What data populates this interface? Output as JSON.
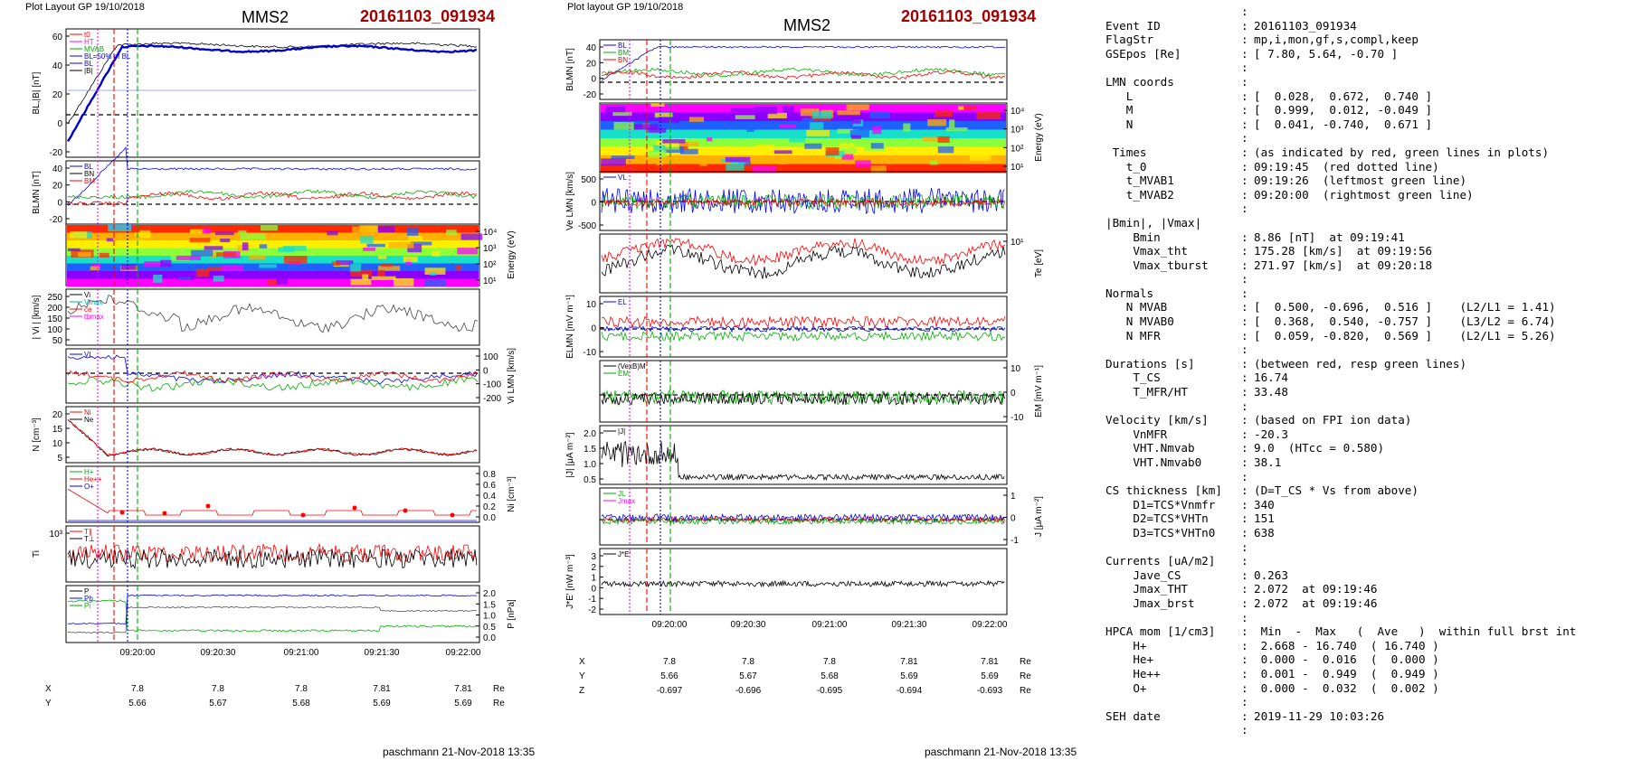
{
  "header": {
    "left_plot_label": "Plot Layout GP 19/10/2018",
    "right_plot_label": "Plot layout GP 19/10/2018",
    "spacecraft": "MMS2",
    "event": "20161103_091934"
  },
  "footer": {
    "signature": "paschmann 21-Nov-2018 13:35"
  },
  "colors": {
    "event_red": "#a00000",
    "bl_blue": "#0000cc"
  },
  "chart_data": [
    {
      "type": "line",
      "title": "MMS2",
      "x_ticks": [
        "09:20:00",
        "09:20:30",
        "09:21:00",
        "09:21:30",
        "09:22:00"
      ],
      "ephemeris": {
        "X": {
          "label": "X",
          "values": [
            "7.8",
            "7.8",
            "7.8",
            "7.81",
            "7.81"
          ],
          "unit": "Re"
        },
        "Y": {
          "label": "Y",
          "values": [
            "5.66",
            "5.67",
            "5.68",
            "5.69",
            "5.69"
          ],
          "unit": "Re"
        },
        "Z": {
          "label": "Z",
          "values": [
            "-0.697",
            "-0.696",
            "-0.695",
            "-0.694",
            "-0.693"
          ],
          "unit": "Re"
        }
      },
      "panels": [
        {
          "ylabel": "BL,|B| [nT]",
          "ylim": [
            -30,
            60
          ],
          "ticks": [
            "60",
            "40",
            "20",
            "0",
            "-20"
          ],
          "legend": [
            "t0",
            "HT",
            "MVAB",
            "BL=50% of BL",
            "BL",
            "|B|"
          ]
        },
        {
          "ylabel": "BLMN [nT]",
          "ylim": [
            -20,
            50
          ],
          "ticks": [
            "40",
            "20",
            "0",
            "-20"
          ],
          "legend": [
            "BL",
            "BN",
            "BM"
          ]
        },
        {
          "ylabel": "Energy (eV)",
          "ticks": [
            "10⁴",
            "10³",
            "10²",
            "10¹"
          ]
        },
        {
          "ylabel": "| Vi | [km/s]",
          "ylim": [
            0,
            280
          ],
          "ticks": [
            "250",
            "200",
            "150",
            "100",
            "50"
          ],
          "legend": [
            "Vi",
            "Vmax",
            "ce",
            "tbmax"
          ]
        },
        {
          "ylabel": "Vi LMN [km/s]",
          "ticks": [
            "100",
            "0",
            "-100",
            "-200"
          ],
          "legend": [
            "VL"
          ]
        },
        {
          "ylabel": "N [cm⁻³]",
          "ylim": [
            0,
            25
          ],
          "ticks": [
            "20",
            "15",
            "10",
            "5"
          ],
          "legend": [
            "Ni",
            "Ne"
          ]
        },
        {
          "ylabel": "Ni [cm⁻³]",
          "ylim": [
            0,
            0.8
          ],
          "ticks": [
            "0.8",
            "0.6",
            "0.4",
            "0.2",
            "0.0"
          ],
          "legend": [
            "H+",
            "He++",
            "O+"
          ]
        },
        {
          "ylabel": "Ti",
          "ticks": [
            "10³"
          ],
          "legend": [
            "T∥",
            "T⊥"
          ]
        },
        {
          "ylabel": "P [nPa]",
          "ylim": [
            0,
            2
          ],
          "ticks": [
            "2.0",
            "1.5",
            "1.0",
            "0.5",
            "0.0"
          ],
          "legend": [
            "P",
            "Pb",
            "Pi"
          ]
        }
      ]
    },
    {
      "type": "line",
      "title": "MMS2",
      "x_ticks": [
        "09:20:00",
        "09:20:30",
        "09:21:00",
        "09:21:30",
        "09:22:00"
      ],
      "ephemeris": {
        "X": {
          "label": "X",
          "values": [
            "7.8",
            "7.8",
            "7.8",
            "7.81",
            "7.81"
          ],
          "unit": "Re"
        },
        "Y": {
          "label": "Y",
          "values": [
            "5.66",
            "5.67",
            "5.68",
            "5.69",
            "5.69"
          ],
          "unit": "Re"
        },
        "Z": {
          "label": "Z",
          "values": [
            "-0.697",
            "-0.696",
            "-0.695",
            "-0.694",
            "-0.693"
          ],
          "unit": "Re"
        }
      },
      "panels": [
        {
          "ylabel": "BLMN [nT]",
          "ticks": [
            "40",
            "20",
            "0",
            "-20"
          ],
          "legend": [
            "BL",
            "BM",
            "BN"
          ]
        },
        {
          "ylabel": "Energy (eV)",
          "ticks": [
            "10⁴",
            "10³",
            "10²",
            "10¹"
          ]
        },
        {
          "ylabel": "Ve LMN [km/s]",
          "ticks": [
            "500",
            "0",
            "-500"
          ],
          "legend": [
            "VL"
          ]
        },
        {
          "ylabel": "Te [eV]",
          "ticks": [
            "10¹"
          ]
        },
        {
          "ylabel": "ELMN [mV m⁻¹]",
          "ticks": [
            "10",
            "0",
            "-10"
          ],
          "legend": [
            "EL"
          ]
        },
        {
          "ylabel": "EM [mV m⁻¹]",
          "ticks": [
            "10",
            "0",
            "-10"
          ],
          "legend": [
            "(VexB)M",
            "EM"
          ]
        },
        {
          "ylabel": "|J| [μA m⁻²]",
          "ticks": [
            "2.0",
            "1.5",
            "1.0",
            "0.5"
          ],
          "legend": [
            "|J|"
          ]
        },
        {
          "ylabel": "J [μA m⁻²]",
          "ticks": [
            "1",
            "0",
            "-1"
          ],
          "legend": [
            "JL",
            "Jmax"
          ]
        },
        {
          "ylabel": "J*E' [nW m⁻³]",
          "ticks": [
            "3",
            "2",
            "1",
            "0",
            "-1",
            "-2"
          ],
          "legend": [
            "J*E'"
          ]
        }
      ]
    }
  ],
  "info_rows": [
    [
      "",
      ":",
      ""
    ],
    [
      "Event ID",
      ":",
      "20161103_091934"
    ],
    [
      "FlagStr",
      ":",
      "mp,i,mon,gf,s,compl,keep"
    ],
    [
      "GSEpos [Re]",
      ":",
      "[ 7.80, 5.64, -0.70 ]"
    ],
    [
      "",
      ":",
      ""
    ],
    [
      "LMN coords",
      ":",
      ""
    ],
    [
      "   L",
      ":",
      "[  0.028,  0.672,  0.740 ]"
    ],
    [
      "   M",
      ":",
      "[  0.999,  0.012, -0.049 ]"
    ],
    [
      "   N",
      ":",
      "[  0.041, -0.740,  0.671 ]"
    ],
    [
      "",
      ":",
      ""
    ],
    [
      " Times",
      ":",
      "(as indicated by red, green lines in plots)"
    ],
    [
      "   t_0",
      ":",
      "09:19:45  (red dotted line)"
    ],
    [
      "   t_MVAB1",
      ":",
      "09:19:26  (leftmost green line)"
    ],
    [
      "   t_MVAB2",
      ":",
      "09:20:00  (rightmost green line)"
    ],
    [
      "",
      ":",
      ""
    ],
    [
      "|Bmin|, |Vmax|",
      "",
      ""
    ],
    [
      "    Bmin",
      ":",
      "8.86 [nT]  at 09:19:41"
    ],
    [
      "    Vmax_tht",
      ":",
      "175.28 [km/s]  at 09:19:56"
    ],
    [
      "    Vmax_tburst",
      ":",
      "271.97 [km/s]  at 09:20:18"
    ],
    [
      "",
      ":",
      ""
    ],
    [
      "Normals",
      ":",
      ""
    ],
    [
      "   N MVAB",
      ":",
      "[  0.500, -0.696,  0.516 ]    (L2/L1 = 1.41)"
    ],
    [
      "   N MVAB0",
      ":",
      "[  0.368,  0.540, -0.757 ]    (L3/L2 = 6.74)"
    ],
    [
      "   N MFR",
      ":",
      "[  0.059, -0.820,  0.569 ]    (L2/L1 = 5.26)"
    ],
    [
      "",
      ":",
      ""
    ],
    [
      "Durations [s]",
      ":",
      "(between red, resp green lines)"
    ],
    [
      "    T_CS",
      ":",
      "16.74"
    ],
    [
      "    T_MFR/HT",
      ":",
      "33.48"
    ],
    [
      "",
      ":",
      ""
    ],
    [
      "Velocity [km/s]",
      ":",
      "(based on FPI ion data)"
    ],
    [
      "    VnMFR",
      ":",
      "-20.3"
    ],
    [
      "    VHT.Nmvab",
      ":",
      "9.0  (HTcc = 0.580)"
    ],
    [
      "    VHT.Nmvab0",
      ":",
      "38.1"
    ],
    [
      "",
      ":",
      ""
    ],
    [
      "CS thickness [km]",
      ":",
      "(D=T_CS * Vs from above)"
    ],
    [
      "    D1=TCS*Vnmfr",
      ":",
      "340"
    ],
    [
      "    D2=TCS*VHTn",
      ":",
      "151"
    ],
    [
      "    D3=TCS*VHTn0",
      ":",
      "638"
    ],
    [
      "",
      ":",
      ""
    ],
    [
      "Currents [uA/m2]",
      ":",
      ""
    ],
    [
      "    Jave_CS",
      ":",
      "0.263"
    ],
    [
      "    Jmax_THT",
      ":",
      "2.072  at 09:19:46"
    ],
    [
      "    Jmax_brst",
      ":",
      "2.072  at 09:19:46"
    ],
    [
      "",
      ":",
      ""
    ],
    [
      "HPCA mom [1/cm3]",
      ":",
      " Min  -  Max   (  Ave   )  within full brst int"
    ],
    [
      "    H+",
      ":",
      " 2.668 - 16.740  ( 16.740 )"
    ],
    [
      "    He+",
      ":",
      " 0.000 -  0.016  (  0.000 )"
    ],
    [
      "    He++",
      ":",
      " 0.001 -  0.949  (  0.949 )"
    ],
    [
      "    O+",
      ":",
      " 0.000 -  0.032  (  0.002 )"
    ],
    [
      "",
      ":",
      ""
    ],
    [
      "SEH date",
      ":",
      "2019-11-29 10:03:26"
    ],
    [
      "",
      ":",
      ""
    ]
  ]
}
